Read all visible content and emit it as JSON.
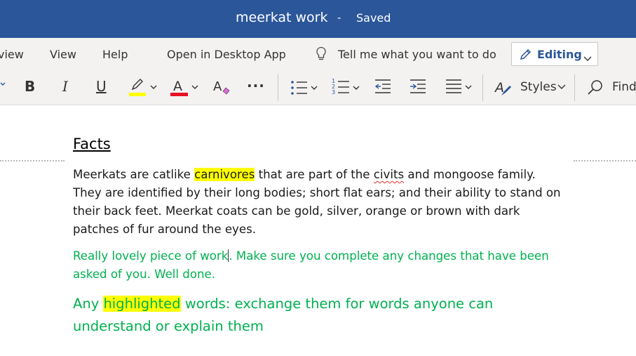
{
  "window": {
    "doc_title": "meerkat work",
    "separator": "-",
    "status": "Saved"
  },
  "menu": {
    "items": [
      "view",
      "View",
      "Help",
      "Open in Desktop App"
    ],
    "tell_me": "Tell me what you want to do",
    "editing": "Editing"
  },
  "toolbar": {
    "bold": "B",
    "italic": "I",
    "underline": "U",
    "more": "···",
    "styles": "Styles",
    "find": "Find",
    "highlight_color": "#ffff00",
    "font_color": "#e81123"
  },
  "document": {
    "heading": "Facts",
    "para": {
      "p1": "Meerkats are catlike ",
      "hl1": "carnivores",
      "p2": " that are part of the ",
      "spell1": "civits",
      "p3": " and mongoose family. They are identified by their long bodies; short flat ears; and their ability to stand on their back feet. Meerkat coats can be gold, silver, orange or brown with dark patches of fur around the eyes."
    },
    "comment": {
      "before_cursor": "Really lovely piece of work",
      "after_cursor": ". Make sure you complete any changes that have been asked of you. Well done."
    },
    "instruction": {
      "t1": "Any ",
      "hl": "highlighted",
      "t2": " words: exchange them for words anyone can understand or explain them"
    },
    "comment_color": "#00b050",
    "highlight_color": "#ffff00"
  }
}
